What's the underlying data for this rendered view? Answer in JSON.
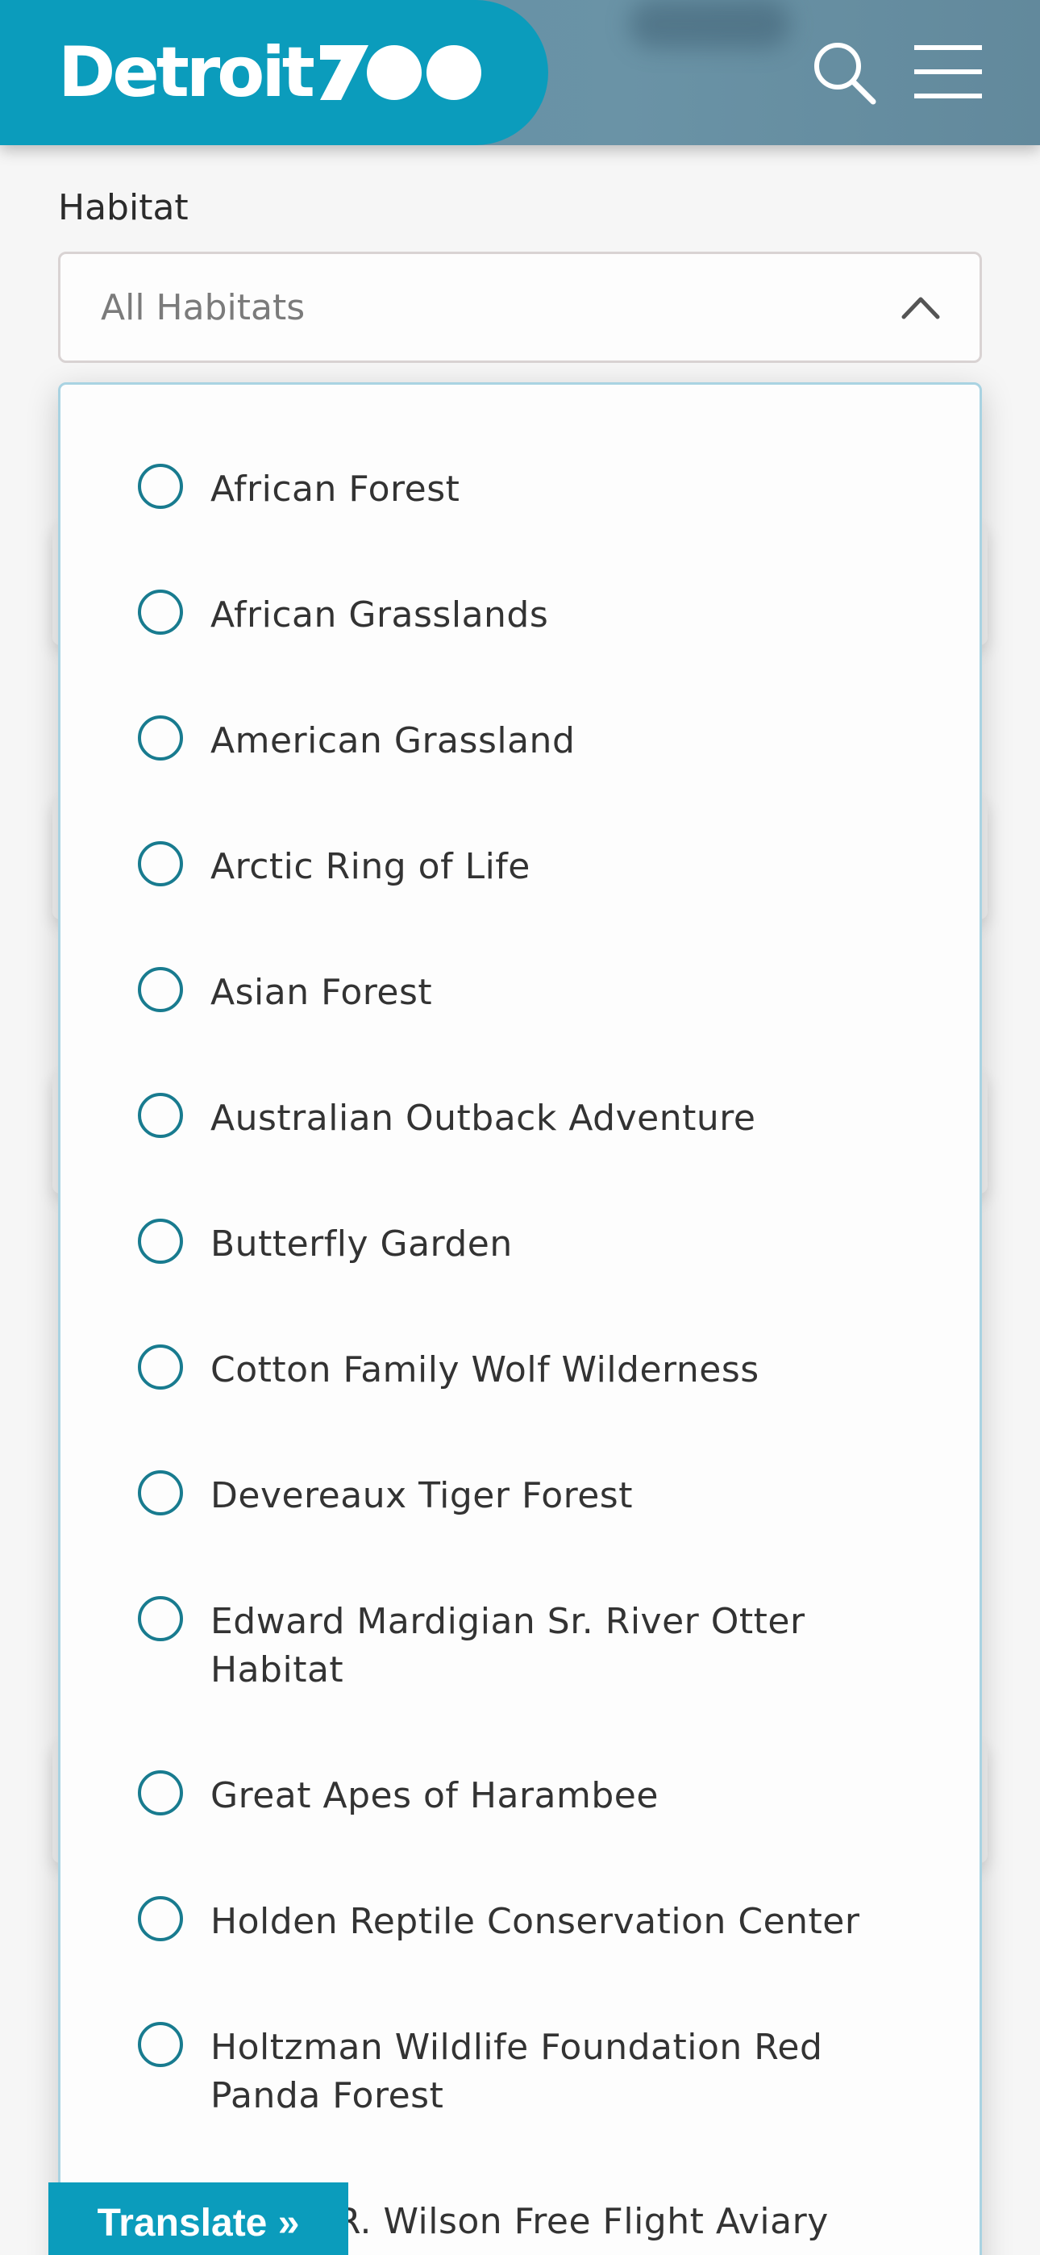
{
  "header": {
    "logo_text": "Detroit",
    "logo_zoo": "ZOO",
    "brand_color": "#0b9cbc",
    "header_color": "#6a93a6",
    "search_icon": "search-icon",
    "menu_icon": "hamburger-menu-icon"
  },
  "filter": {
    "label": "Habitat",
    "selected_value": "All Habitats",
    "expanded": true
  },
  "habitats": [
    "African Forest",
    "African Grasslands",
    "American Grassland",
    "Arctic Ring of Life",
    "Asian Forest",
    "Australian Outback Adventure",
    "Butterfly Garden",
    "Cotton Family Wolf Wilderness",
    "Devereaux Tiger Forest",
    "Edward Mardigian Sr. River Otter Habitat",
    "Great Apes of Harambee",
    "Holden Reptile Conservation Center",
    "Holtzman Wildlife Foundation Red Panda Forest",
    "R. Wilson Free Flight Aviary"
  ],
  "translate": {
    "label": "Translate »"
  }
}
